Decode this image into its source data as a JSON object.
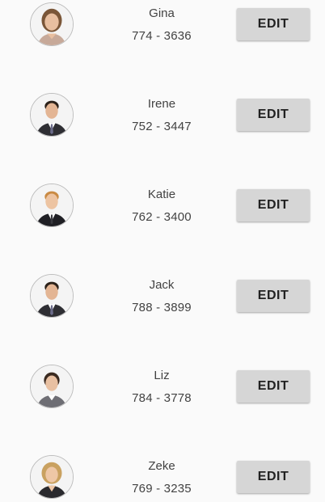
{
  "contacts": [
    {
      "name": "Gina",
      "phone": "774 - 3636",
      "edit_label": "EDIT",
      "avatar": "woman-brown-hair-photo"
    },
    {
      "name": "Irene",
      "phone": "752 - 3447",
      "edit_label": "EDIT",
      "avatar": "man-suit-photo"
    },
    {
      "name": "Katie",
      "phone": "762 - 3400",
      "edit_label": "EDIT",
      "avatar": "man-blond-suit-photo"
    },
    {
      "name": "Jack",
      "phone": "788 - 3899",
      "edit_label": "EDIT",
      "avatar": "man-suit-photo"
    },
    {
      "name": "Liz",
      "phone": "784 - 3778",
      "edit_label": "EDIT",
      "avatar": "woman-dark-hair-photo"
    },
    {
      "name": "Zeke",
      "phone": "769 - 3235",
      "edit_label": "EDIT",
      "avatar": "woman-blonde-hair-photo"
    }
  ],
  "colors": {
    "background": "#fafafa",
    "button": "#d6d6d6",
    "text": "#424242"
  }
}
